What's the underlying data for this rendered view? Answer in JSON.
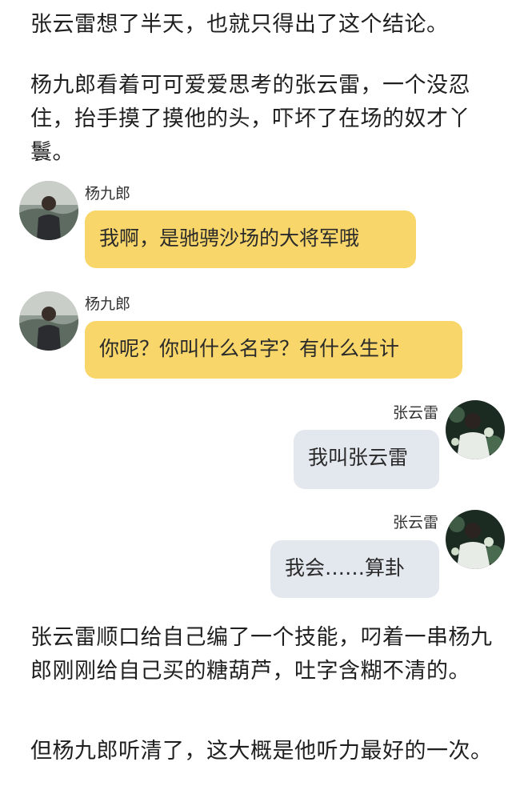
{
  "paragraphs": [
    "张云雷想了半天，也就只得出了这个结论。",
    "杨九郎看着可可爱爱思考的张云雷，一个没忍住，抬手摸了摸他的头，吓坏了在场的奴才丫鬟。",
    "张云雷顺口给自己编了一个技能，叼着一串杨九郎刚刚给自己买的糖葫芦，吐字含糊不清的。",
    "但杨九郎听清了，这大概是他听力最好的一次。"
  ],
  "messages": [
    {
      "side": "left",
      "sender": "杨九郎",
      "text": "我啊，是驰骋沙场的大将军哦",
      "avatar": "avatar-yang-icon"
    },
    {
      "side": "left",
      "sender": "杨九郎",
      "text": "你呢？你叫什么名字？有什么生计",
      "avatar": "avatar-yang-icon"
    },
    {
      "side": "right",
      "sender": "张云雷",
      "text": "我叫张云雷",
      "avatar": "avatar-zhang-icon"
    },
    {
      "side": "right",
      "sender": "张云雷",
      "text": "我会……算卦",
      "avatar": "avatar-zhang-icon"
    }
  ],
  "colors": {
    "left_bubble": "#f8d66a",
    "right_bubble": "#e3e7ee",
    "text": "#1f1f1f"
  }
}
